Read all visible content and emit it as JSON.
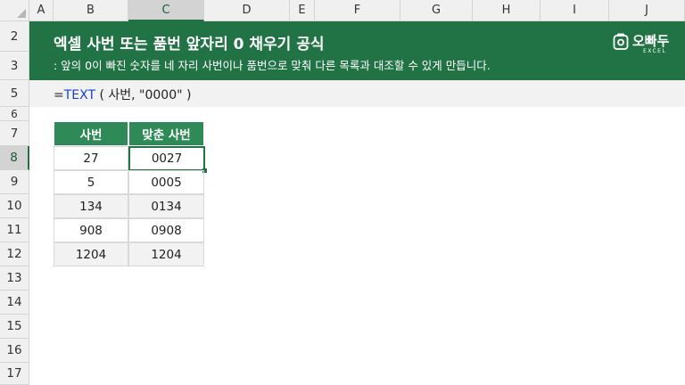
{
  "columns": [
    "A",
    "B",
    "C",
    "D",
    "E",
    "F",
    "G",
    "H",
    "I",
    "J"
  ],
  "rows": [
    "2",
    "3",
    "5",
    "6",
    "7",
    "8",
    "9",
    "10",
    "11",
    "12",
    "13",
    "14",
    "15",
    "16",
    "17"
  ],
  "banner": {
    "title": "엑셀 사번 또는 품번 앞자리 0 채우기 공식",
    "subtitle": ": 앞의 0이 빠진 숫자를 네 자리 사번이나 품번으로 맞춰 다른 목록과 대조할 수 있게 만듭니다.",
    "logo_text": "오빠두",
    "logo_sub": "EXCEL"
  },
  "formula": {
    "prefix": "=",
    "fn": "TEXT",
    "args": " ( 사번, \"0000\" )"
  },
  "table": {
    "headers": [
      "사번",
      "맞춘 사번"
    ],
    "rows": [
      [
        "27",
        "0027"
      ],
      [
        "5",
        "0005"
      ],
      [
        "134",
        "0134"
      ],
      [
        "908",
        "0908"
      ],
      [
        "1204",
        "1204"
      ]
    ]
  },
  "selection": {
    "column": "C",
    "row": "8"
  },
  "colors": {
    "accent": "#217346",
    "header_fill": "#2e8b57",
    "formula_fn": "#1a3fd6"
  }
}
